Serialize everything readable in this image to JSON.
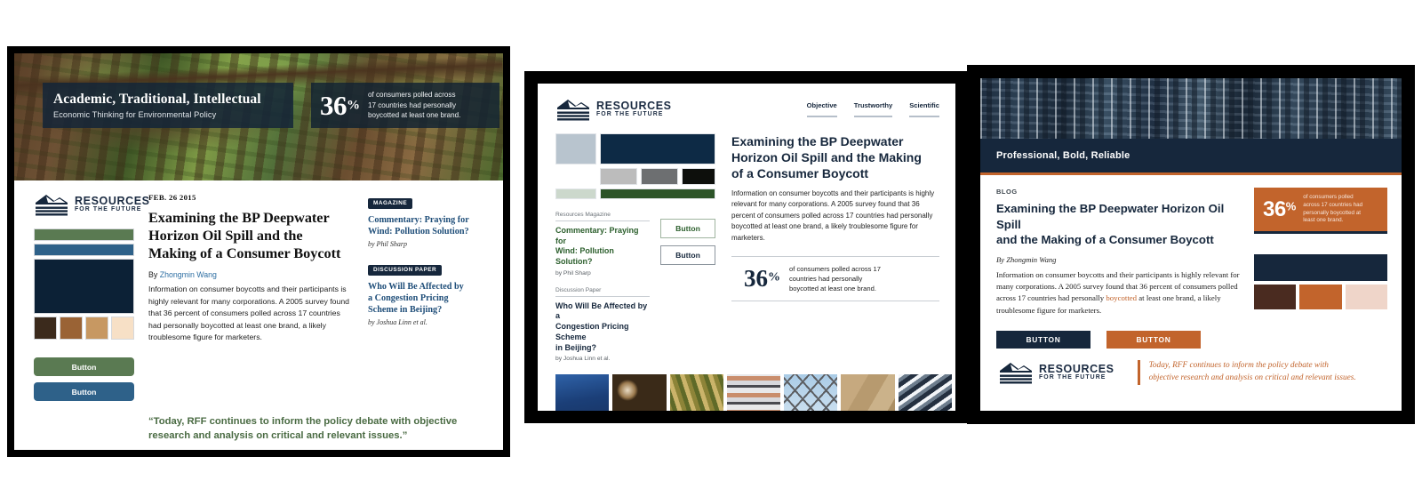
{
  "brand": {
    "logo_line1": "RESOURCES",
    "logo_line2": "FOR THE FUTURE",
    "logo_icon": "rff-mountain-logo-icon",
    "colors": {
      "navy": "#0f2236",
      "dark_navy": "#16273c",
      "green": "#5a7a52",
      "blue": "#2e6189",
      "orange": "#c2642c",
      "forest": "#2c5428"
    }
  },
  "article": {
    "date": "FEB. 26 2015",
    "kicker_blog": "BLOG",
    "headline": "Examining the BP Deepwater Horizon Oil Spill and the Making of a Consumer Boycott",
    "headline_p1_l1": "Examining the BP Deepwater",
    "headline_p1_l2": "Horizon Oil Spill and the",
    "headline_p1_l3": "Making of a Consumer Boycott",
    "byline_prefix": "By ",
    "author": "Zhongmin Wang",
    "byline_italic": "By Zhongmin Wang",
    "body": "Information on consumer boycotts and their participants is highly relevant for many corporations. A 2005 survey found that 36 percent of consumers polled across 17 countries had personally boycotted at least one brand, a likely troublesome figure for marketers.",
    "body_p3_a": "Information on consumer boycotts and their participants is highly relevant for many corporations. A 2005 survey found that 36 percent of consumers polled across 17 countries had personally ",
    "body_p3_hl": "boycotted",
    "body_p3_b": " at least one brand, a likely troublesome figure for marketers."
  },
  "stat": {
    "number": "36",
    "percent": "%",
    "caption_l1": "of consumers polled across",
    "caption_l2": "17 countries had personally",
    "caption_l3": "boycotted at least one brand.",
    "caption_p2_l1": "of consumers polled across 17",
    "caption_p2_l2": "countries had personally",
    "caption_p2_l3": "boycotted at least one brand.",
    "caption_p3_l1": "of consumers polled",
    "caption_p3_l2": "across 17 countries had",
    "caption_p3_l3": "personally boycotted at",
    "caption_p3_l4": "least one brand."
  },
  "quote": {
    "panel1": "“Today, RFF continues to inform the policy debate with objective research and analysis on critical and relevant issues.”",
    "panel3_l1": "Today, RFF continues to inform the policy debate with",
    "panel3_l2": "objective research and analysis on critical and relevant issues."
  },
  "panel1": {
    "hero_title": "Academic, Traditional, Intellectual",
    "hero_subtitle": "Economic Thinking for Environmental Policy",
    "buttons": [
      {
        "label": "Button",
        "color": "#5a7a52"
      },
      {
        "label": "Button",
        "color": "#2e6189"
      }
    ],
    "swatches": {
      "bars": [
        "#5a7a52",
        "#2e6189"
      ],
      "big": "#0c2136",
      "squares": [
        "#3b2a1c",
        "#9a6335",
        "#c79862",
        "#f7e0c6"
      ]
    },
    "related": [
      {
        "tag": "MAGAZINE",
        "title_l1": "Commentary: Praying for",
        "title_l2": "Wind: Pollution Solution?",
        "by": "by Phil Sharp"
      },
      {
        "tag": "DISCUSSION PAPER",
        "title_l1": "Who Will Be Affected by",
        "title_l2": "a Congestion Pricing",
        "title_l3": "Scheme in Beijing?",
        "by": "by Joshua Linn et al."
      }
    ]
  },
  "panel2": {
    "nav": [
      "Objective",
      "Trustworthy",
      "Scientific"
    ],
    "headline_l1": "Examining the BP Deepwater",
    "headline_l2": "Horizon Oil Spill and the Making",
    "headline_l3": "of a Consumer Boycott",
    "swatches": {
      "row1": [
        "#b8c4ce",
        "#0d2a45"
      ],
      "row2": [
        "#ffffff",
        "#bcbcbc",
        "#6d6f71",
        "#0d0f0c"
      ],
      "row3": [
        "#ccd8cc",
        "#2c5428"
      ]
    },
    "related": [
      {
        "kicker": "Resources Magazine",
        "title_l1": "Commentary: Praying for",
        "title_l2": "Wind: Pollution Solution?",
        "by": "by Phil Sharp"
      },
      {
        "kicker": "Discussion Paper",
        "title_l1": "Who Will Be Affected by a",
        "title_l2": "Congestion Pricing Scheme",
        "title_l3": "in Beijing?",
        "by": "by Joshua Linn et al."
      }
    ],
    "buttons": [
      {
        "label": "Button",
        "style": "green"
      },
      {
        "label": "Button",
        "style": "dark"
      }
    ],
    "thumbnails": [
      "water-waves-thumbnail",
      "cut-logs-thumbnail",
      "wheat-field-thumbnail",
      "crowd-stadium-thumbnail",
      "power-transmission-tower-thumbnail",
      "aerial-farmland-thumbnail",
      "satellite-coastline-thumbnail"
    ]
  },
  "panel3": {
    "band_title": "Professional, Bold, Reliable",
    "headline_l1": "Examining the BP Deepwater Horizon Oil Spill",
    "headline_l2": "and the Making of a Consumer Boycott",
    "buttons": [
      {
        "label": "BUTTON",
        "color": "#16273c"
      },
      {
        "label": "BUTTON",
        "color": "#c2642c"
      }
    ],
    "swatches": {
      "big": "#16273c",
      "squares": [
        "#4a2b20",
        "#c2642c",
        "#efd5c9"
      ]
    }
  }
}
